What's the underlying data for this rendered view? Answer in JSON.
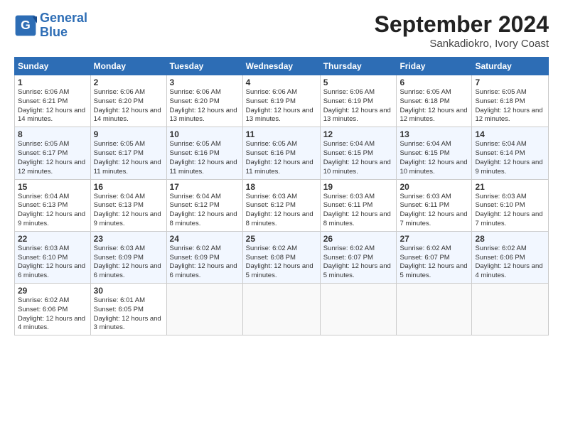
{
  "logo": {
    "line1": "General",
    "line2": "Blue"
  },
  "title": "September 2024",
  "location": "Sankadiokro, Ivory Coast",
  "days_of_week": [
    "Sunday",
    "Monday",
    "Tuesday",
    "Wednesday",
    "Thursday",
    "Friday",
    "Saturday"
  ],
  "weeks": [
    [
      {
        "day": "1",
        "sunrise": "6:06 AM",
        "sunset": "6:21 PM",
        "daylight": "12 hours and 14 minutes."
      },
      {
        "day": "2",
        "sunrise": "6:06 AM",
        "sunset": "6:20 PM",
        "daylight": "12 hours and 14 minutes."
      },
      {
        "day": "3",
        "sunrise": "6:06 AM",
        "sunset": "6:20 PM",
        "daylight": "12 hours and 13 minutes."
      },
      {
        "day": "4",
        "sunrise": "6:06 AM",
        "sunset": "6:19 PM",
        "daylight": "12 hours and 13 minutes."
      },
      {
        "day": "5",
        "sunrise": "6:06 AM",
        "sunset": "6:19 PM",
        "daylight": "12 hours and 13 minutes."
      },
      {
        "day": "6",
        "sunrise": "6:05 AM",
        "sunset": "6:18 PM",
        "daylight": "12 hours and 12 minutes."
      },
      {
        "day": "7",
        "sunrise": "6:05 AM",
        "sunset": "6:18 PM",
        "daylight": "12 hours and 12 minutes."
      }
    ],
    [
      {
        "day": "8",
        "sunrise": "6:05 AM",
        "sunset": "6:17 PM",
        "daylight": "12 hours and 12 minutes."
      },
      {
        "day": "9",
        "sunrise": "6:05 AM",
        "sunset": "6:17 PM",
        "daylight": "12 hours and 11 minutes."
      },
      {
        "day": "10",
        "sunrise": "6:05 AM",
        "sunset": "6:16 PM",
        "daylight": "12 hours and 11 minutes."
      },
      {
        "day": "11",
        "sunrise": "6:05 AM",
        "sunset": "6:16 PM",
        "daylight": "12 hours and 11 minutes."
      },
      {
        "day": "12",
        "sunrise": "6:04 AM",
        "sunset": "6:15 PM",
        "daylight": "12 hours and 10 minutes."
      },
      {
        "day": "13",
        "sunrise": "6:04 AM",
        "sunset": "6:15 PM",
        "daylight": "12 hours and 10 minutes."
      },
      {
        "day": "14",
        "sunrise": "6:04 AM",
        "sunset": "6:14 PM",
        "daylight": "12 hours and 9 minutes."
      }
    ],
    [
      {
        "day": "15",
        "sunrise": "6:04 AM",
        "sunset": "6:13 PM",
        "daylight": "12 hours and 9 minutes."
      },
      {
        "day": "16",
        "sunrise": "6:04 AM",
        "sunset": "6:13 PM",
        "daylight": "12 hours and 9 minutes."
      },
      {
        "day": "17",
        "sunrise": "6:04 AM",
        "sunset": "6:12 PM",
        "daylight": "12 hours and 8 minutes."
      },
      {
        "day": "18",
        "sunrise": "6:03 AM",
        "sunset": "6:12 PM",
        "daylight": "12 hours and 8 minutes."
      },
      {
        "day": "19",
        "sunrise": "6:03 AM",
        "sunset": "6:11 PM",
        "daylight": "12 hours and 8 minutes."
      },
      {
        "day": "20",
        "sunrise": "6:03 AM",
        "sunset": "6:11 PM",
        "daylight": "12 hours and 7 minutes."
      },
      {
        "day": "21",
        "sunrise": "6:03 AM",
        "sunset": "6:10 PM",
        "daylight": "12 hours and 7 minutes."
      }
    ],
    [
      {
        "day": "22",
        "sunrise": "6:03 AM",
        "sunset": "6:10 PM",
        "daylight": "12 hours and 6 minutes."
      },
      {
        "day": "23",
        "sunrise": "6:03 AM",
        "sunset": "6:09 PM",
        "daylight": "12 hours and 6 minutes."
      },
      {
        "day": "24",
        "sunrise": "6:02 AM",
        "sunset": "6:09 PM",
        "daylight": "12 hours and 6 minutes."
      },
      {
        "day": "25",
        "sunrise": "6:02 AM",
        "sunset": "6:08 PM",
        "daylight": "12 hours and 5 minutes."
      },
      {
        "day": "26",
        "sunrise": "6:02 AM",
        "sunset": "6:07 PM",
        "daylight": "12 hours and 5 minutes."
      },
      {
        "day": "27",
        "sunrise": "6:02 AM",
        "sunset": "6:07 PM",
        "daylight": "12 hours and 5 minutes."
      },
      {
        "day": "28",
        "sunrise": "6:02 AM",
        "sunset": "6:06 PM",
        "daylight": "12 hours and 4 minutes."
      }
    ],
    [
      {
        "day": "29",
        "sunrise": "6:02 AM",
        "sunset": "6:06 PM",
        "daylight": "12 hours and 4 minutes."
      },
      {
        "day": "30",
        "sunrise": "6:01 AM",
        "sunset": "6:05 PM",
        "daylight": "12 hours and 3 minutes."
      },
      null,
      null,
      null,
      null,
      null
    ]
  ]
}
